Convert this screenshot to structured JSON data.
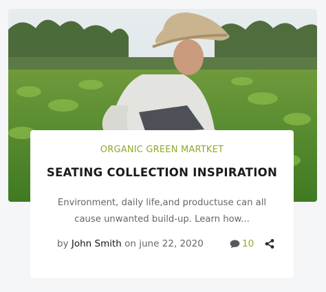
{
  "post": {
    "category": "ORGANIC GREEN MARTKET",
    "title": "SEATING COLLECTION INSPIRATION",
    "excerpt": "Environment, daily life,and productuse can all cause unwanted build-up. Learn how...",
    "meta": {
      "by_prefix": "by",
      "author": "John Smith",
      "date_text": "on june 22, 2020"
    },
    "comments_count": "10",
    "icons": [
      "comment-icon",
      "share-icon"
    ],
    "image_alt": "farmer crouching in a field"
  },
  "colors": {
    "accent": "#8bab2a",
    "title": "#1b1b1b",
    "text": "#666666",
    "background": "#f5f6f8"
  }
}
